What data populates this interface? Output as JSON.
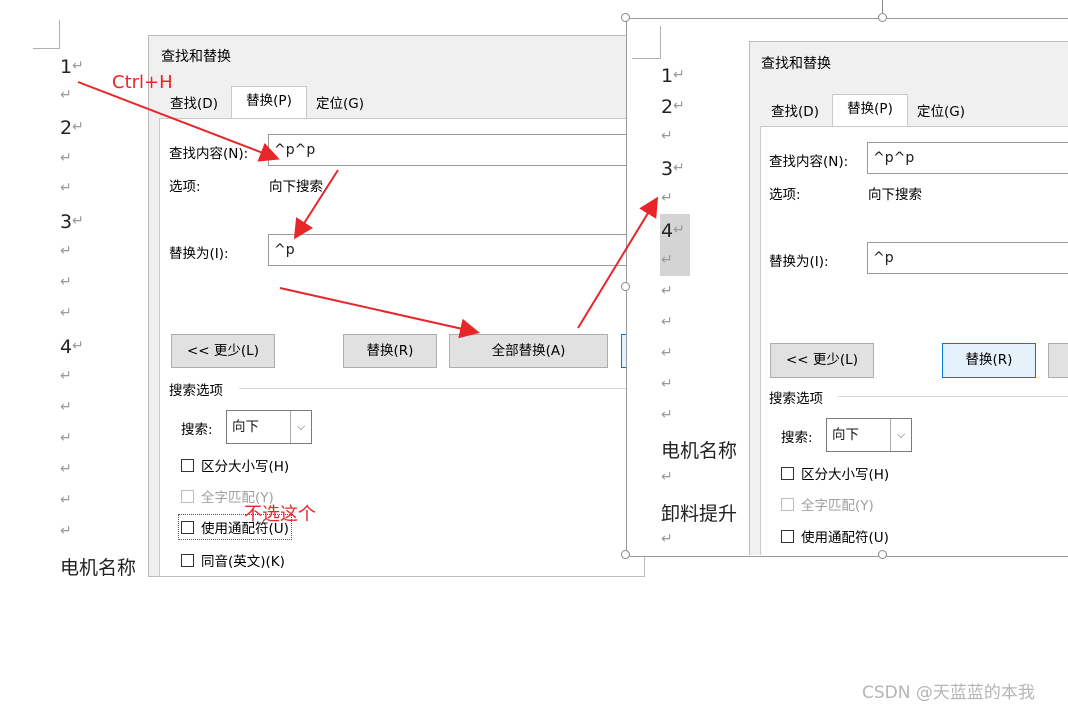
{
  "left": {
    "doc": {
      "numbers": [
        "1",
        "2",
        "3",
        "4"
      ],
      "motor_text": "电机名称",
      "para_mark": "↵"
    },
    "dialog": {
      "title": "查找和替换",
      "tabs": [
        "查找(D)",
        "替换(P)",
        "定位(G)"
      ],
      "find_label": "查找内容(N):",
      "find_value": "^p^p",
      "options_label": "选项:",
      "options_value": "向下搜索",
      "replace_label": "替换为(I):",
      "replace_value": "^p",
      "less_button": "<< 更少(L)",
      "replace_button": "替换(R)",
      "replace_all_button": "全部替换(A)",
      "search_options": "搜索选项",
      "search_label": "搜索:",
      "search_value": "向下",
      "checkboxes": [
        "区分大小写(H)",
        "全字匹配(Y)",
        "使用通配符(U)",
        "同音(英文)(K)"
      ]
    },
    "annotations": {
      "shortcut": "Ctrl+H",
      "note": "不选这个"
    }
  },
  "right": {
    "doc": {
      "numbers": [
        "1",
        "2",
        "3",
        "4"
      ],
      "motor_text": "电机名称",
      "unload_text": "卸料提升"
    },
    "dialog": {
      "title": "查找和替换",
      "tabs": [
        "查找(D)",
        "替换(P)",
        "定位(G)"
      ],
      "find_label": "查找内容(N):",
      "find_value": "^p^p",
      "options_label": "选项:",
      "options_value": "向下搜索",
      "replace_label": "替换为(I):",
      "replace_value": "^p",
      "less_button": "<< 更少(L)",
      "replace_button": "替换(R)",
      "search_options": "搜索选项",
      "search_label": "搜索:",
      "search_value": "向下",
      "checkboxes": [
        "区分大小写(H)",
        "全字匹配(Y)",
        "使用通配符(U)"
      ]
    }
  },
  "watermark": "CSDN @天蓝蓝的本我",
  "colors": {
    "annotation": "#e8262a",
    "accent": "#0078d7"
  }
}
